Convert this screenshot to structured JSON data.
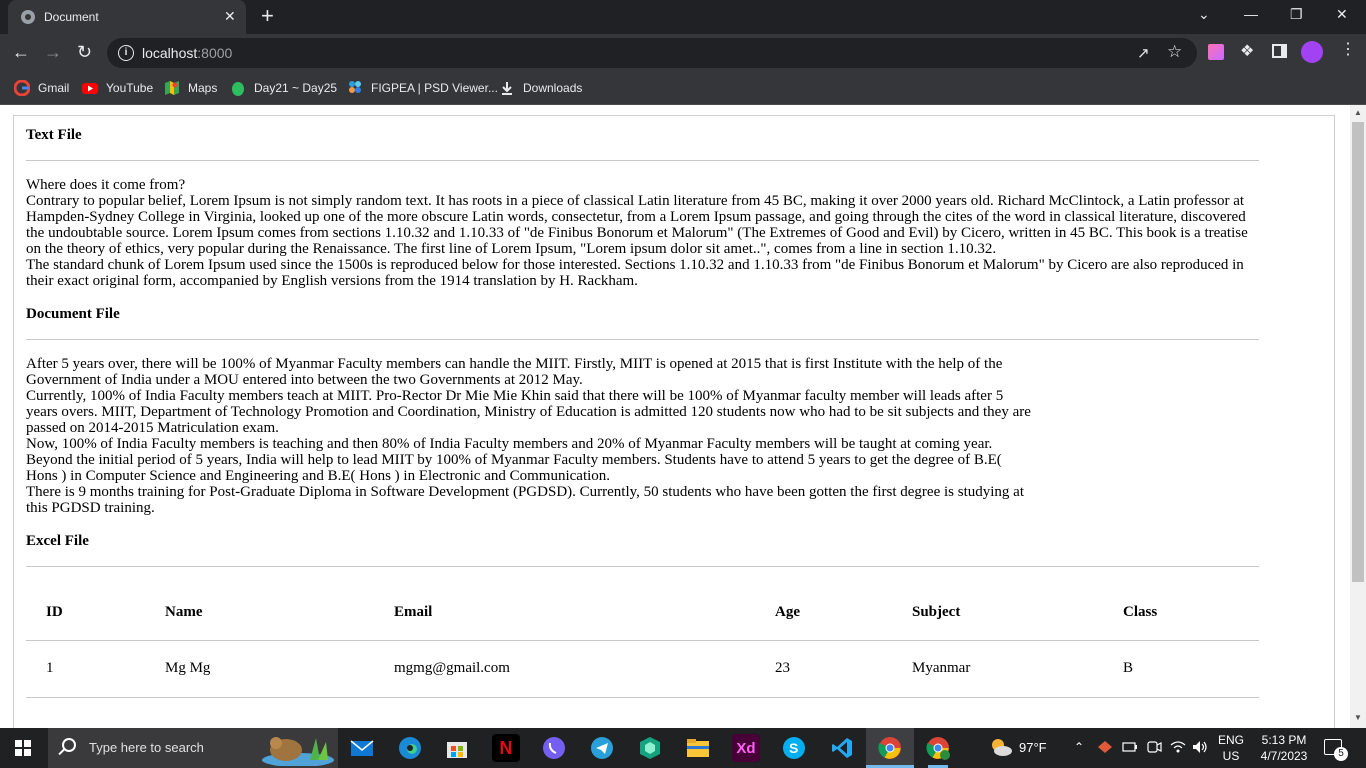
{
  "browser": {
    "tab_title": "Document",
    "tab_close": "✕",
    "new_tab": "+",
    "window_controls": {
      "menu": "⌄",
      "minimize": "—",
      "restore": "❐",
      "close": "✕"
    },
    "url_host": "localhost",
    "url_port": ":8000",
    "bookmarks": [
      {
        "label": "Gmail",
        "icon": "google-icon"
      },
      {
        "label": "YouTube",
        "icon": "youtube-icon"
      },
      {
        "label": "Maps",
        "icon": "maps-icon"
      },
      {
        "label": "Day21 ~ Day25",
        "icon": "evernote-icon"
      },
      {
        "label": "FIGPEA | PSD Viewer...",
        "icon": "figpea-icon"
      },
      {
        "label": "Downloads",
        "icon": "download-icon"
      }
    ]
  },
  "page": {
    "sections": [
      {
        "heading": "Text File",
        "paragraphs": [
          "Where does it come from?",
          "Contrary to popular belief, Lorem Ipsum is not simply random text. It has roots in a piece of classical Latin literature from 45 BC, making it over 2000 years old. Richard McClintock, a Latin professor at Hampden-Sydney College in Virginia, looked up one of the more obscure Latin words, consectetur, from a Lorem Ipsum passage, and going through the cites of the word in classical literature, discovered the undoubtable source. Lorem Ipsum comes from sections 1.10.32 and 1.10.33 of \"de Finibus Bonorum et Malorum\" (The Extremes of Good and Evil) by Cicero, written in 45 BC. This book is a treatise on the theory of ethics, very popular during the Renaissance. The first line of Lorem Ipsum, \"Lorem ipsum dolor sit amet..\", comes from a line in section 1.10.32.",
          "The standard chunk of Lorem Ipsum used since the 1500s is reproduced below for those interested. Sections 1.10.32 and 1.10.33 from \"de Finibus Bonorum et Malorum\" by Cicero are also reproduced in their exact original form, accompanied by English versions from the 1914 translation by H. Rackham."
        ]
      },
      {
        "heading": "Document File",
        "paragraphs": [
          "After 5 years over, there will be 100% of Myanmar Faculty members can handle the MIIT. Firstly, MIIT is opened at 2015 that is first Institute with the help of the Government of India under a MOU entered into between the two Governments at 2012 May.",
          "Currently, 100% of India Faculty members teach at MIIT. Pro-Rector Dr Mie Mie Khin said that there will be 100% of Myanmar faculty member will leads after 5 years overs. MIIT, Department of Technology Promotion and Coordination, Ministry of Education is admitted 120 students now who had to be sit subjects and they are passed on 2014-2015 Matriculation exam.",
          "Now, 100% of India Faculty members is teaching and then 80% of India Faculty members and 20% of Myanmar Faculty members will be taught at coming year. Beyond the initial period of 5 years, India will help to lead MIIT by 100% of Myanmar Faculty members. Students have to attend 5 years to get the degree of B.E( Hons ) in Computer Science and Engineering and B.E( Hons ) in Electronic and Communication.",
          "There is 9 months training for Post-Graduate Diploma in Software Development (PGDSD). Currently, 50 students who have been gotten the first degree is studying at this PGDSD training."
        ]
      },
      {
        "heading": "Excel File",
        "table": {
          "headers": [
            "ID",
            "Name",
            "Email",
            "Age",
            "Subject",
            "Class"
          ],
          "rows": [
            [
              "1",
              "Mg Mg",
              "mgmg@gmail.com",
              "23",
              "Myanmar",
              "B"
            ],
            [
              "",
              "",
              "",
              "",
              "",
              ""
            ]
          ]
        }
      }
    ]
  },
  "taskbar": {
    "search_placeholder": "Type here to search",
    "apps": [
      "mail",
      "edge",
      "store",
      "netflix",
      "viber",
      "telegram",
      "shield",
      "file-explorer",
      "adobe-xd",
      "skype",
      "vscode",
      "chrome",
      "chrome-profile"
    ],
    "weather": "97°F",
    "language": "ENG",
    "region": "US",
    "time": "5:13 PM",
    "date": "4/7/2023",
    "notifications": "5"
  }
}
